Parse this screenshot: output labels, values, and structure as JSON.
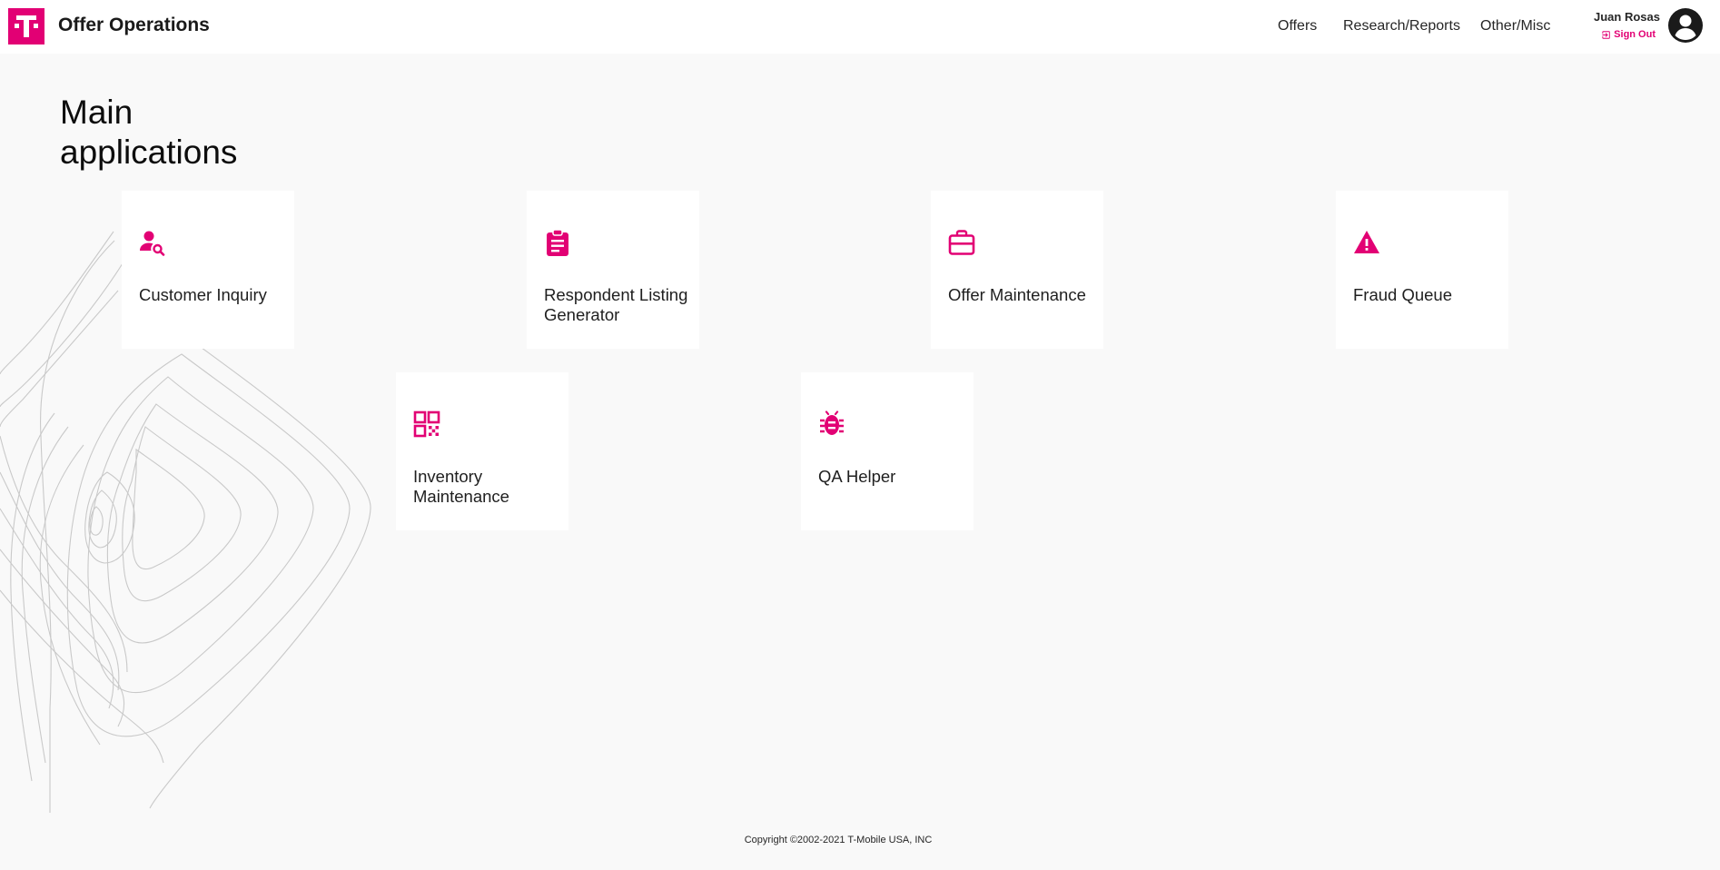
{
  "header": {
    "app_title": "Offer Operations",
    "logo_letter": "T",
    "nav": [
      "Offers",
      "Research/Reports",
      "Other/Misc"
    ],
    "user_name": "Juan Rosas",
    "sign_out_label": "Sign Out"
  },
  "main": {
    "heading_line1": "Main",
    "heading_line2": "applications",
    "cards": [
      {
        "label": "Customer Inquiry",
        "icon": "person-search-icon"
      },
      {
        "label": "Respondent Listing Generator",
        "icon": "clipboard-icon"
      },
      {
        "label": "Offer Maintenance",
        "icon": "briefcase-icon"
      },
      {
        "label": "Fraud Queue",
        "icon": "warning-icon"
      },
      {
        "label": "Inventory Maintenance",
        "icon": "qr-code-icon"
      },
      {
        "label": "QA Helper",
        "icon": "bug-icon"
      }
    ]
  },
  "footer": {
    "copyright": "Copyright ©2002-2021 T-Mobile USA, INC"
  },
  "colors": {
    "brand": "#e20074",
    "background": "#f9f9f9",
    "card": "#ffffff",
    "contour_lines": "#c9c9c9"
  }
}
